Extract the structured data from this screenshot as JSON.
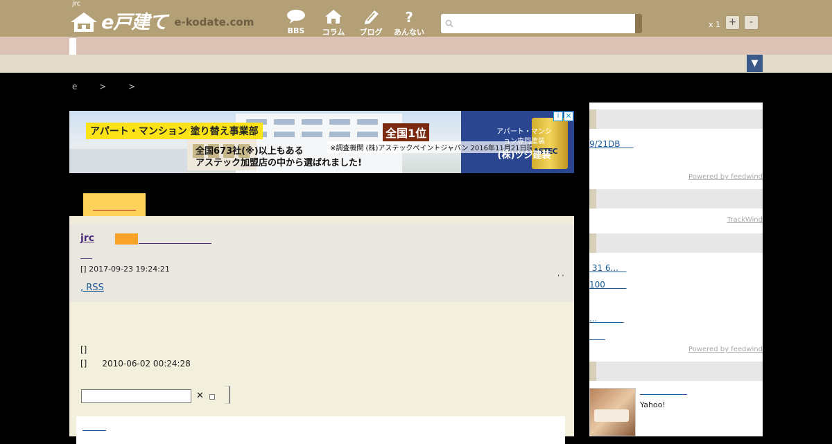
{
  "header": {
    "site_tag": "jrc",
    "logo_text": "e戸建て",
    "logo_domain": "e-kodate.com",
    "nav": [
      {
        "label": "BBS",
        "icon": "speech-bubble-icon"
      },
      {
        "label": "コラム",
        "icon": "house-icon"
      },
      {
        "label": "ブログ",
        "icon": "pen-icon"
      },
      {
        "label": "あんない",
        "icon": "question-icon"
      }
    ],
    "search_placeholder": "",
    "zoom_label": "x 1",
    "zoom_in": "+",
    "zoom_out": "-",
    "dropdown_glyph": "▼"
  },
  "breadcrumb": "e > >",
  "ad": {
    "headline": "アパート・マンション 塗り替え事業部",
    "line1": "全国673社(※)以上もある",
    "line2": "アステック加盟店の中から選ばれました!",
    "rank": "全国1位",
    "source": "※調査機関 (株)アステックペイントジャパン 2016年11月21日現在",
    "company_sub": "アパート・マンション専門塗装",
    "company": "(株)ツジ建装",
    "can_label": "ASTEC",
    "info": "i",
    "close": "✕"
  },
  "post": {
    "title": "jrc",
    "date": "[] 2017-09-23 19:24:21",
    "dots": ", ,",
    "rss": ", RSS",
    "body_line1": "[]",
    "body_line2_prefix": "[]",
    "body_line2_date": "2010-06-02 00:24:28",
    "reply_x": "✕"
  },
  "sidebar": {
    "feed1_link": "9/21DB     ",
    "powered1": "Powered by feedwind",
    "trackwind": "TrackWind",
    "feed2_links": [
      " 31 6...   ",
      "100        ",
      "...          ",
      "      "
    ],
    "powered2": "Powered by feedwind",
    "yahoo_text": "Yahoo!"
  }
}
